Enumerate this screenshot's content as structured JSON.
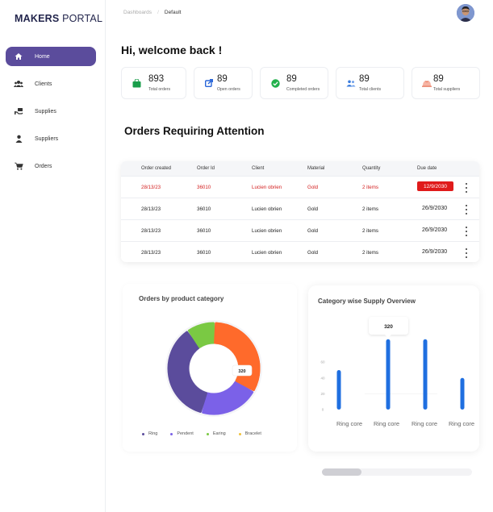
{
  "brand": {
    "bold": "MAKERS",
    "light": "PORTAL"
  },
  "nav": [
    {
      "label": "Home",
      "icon": "home-icon",
      "active": true
    },
    {
      "label": "Clients",
      "icon": "users-icon"
    },
    {
      "label": "Supplies",
      "icon": "supplies-icon"
    },
    {
      "label": "Suppliers",
      "icon": "person-icon"
    },
    {
      "label": "Orders",
      "icon": "cart-icon"
    }
  ],
  "breadcrumb": {
    "parent": "Dashboards",
    "separator": "/",
    "current": "Default"
  },
  "welcome": "Hi, welcome back !",
  "stats": [
    {
      "value": "893",
      "label": "Total orders",
      "icon": "bag-icon",
      "color": "#1a9e4b"
    },
    {
      "value": "89",
      "label": "Open orders",
      "icon": "open-box-icon",
      "color": "#2a66d8"
    },
    {
      "value": "89",
      "label": "Completed orders",
      "icon": "check-circle-icon",
      "color": "#22b14c"
    },
    {
      "value": "89",
      "label": "Total clients",
      "icon": "clients-icon",
      "color": "#3b7ddd"
    },
    {
      "value": "89",
      "label": "Total suppliers",
      "icon": "suppliers-icon",
      "color": "#e8785e"
    }
  ],
  "orders_title": "Orders Requiring  Attention",
  "table": {
    "columns": [
      "Order created",
      "Order Id",
      "Client",
      "Material",
      "Quantity",
      "Due date"
    ],
    "rows": [
      {
        "created": "28/13/23",
        "id": "36010",
        "client": "Lucien obrien",
        "material": "Gold",
        "quantity": "2 items",
        "due": "12/9/2030",
        "alert": true
      },
      {
        "created": "28/13/23",
        "id": "36010",
        "client": "Lucien obrien",
        "material": "Gold",
        "quantity": "2 items",
        "due": "26/9/2030",
        "alert": false
      },
      {
        "created": "28/13/23",
        "id": "36010",
        "client": "Lucien obrien",
        "material": "Gold",
        "quantity": "2 items",
        "due": "26/9/2030",
        "alert": false
      },
      {
        "created": "28/13/23",
        "id": "36010",
        "client": "Lucien obrien",
        "material": "Gold",
        "quantity": "2 items",
        "due": "26/9/2030",
        "alert": false
      }
    ]
  },
  "donut": {
    "title": "Orders by product category",
    "tooltip": "320",
    "legend": [
      {
        "label": "Ring",
        "color": "#5b4c9c"
      },
      {
        "label": "Pendent",
        "color": "#7b61e8"
      },
      {
        "label": "Earing",
        "color": "#7ac943"
      },
      {
        "label": "Bracelet",
        "color": "#f0c23b"
      }
    ]
  },
  "bar": {
    "title": "Category wise Supply Overview",
    "tooltip": "320"
  },
  "colors": {
    "accent": "#5b4c9c",
    "alert": "#e01b1b",
    "bar": "#1f6fe0"
  },
  "chart_data": [
    {
      "type": "pie",
      "title": "Orders by product category",
      "labels": [
        "Ring",
        "Pendent",
        "Earing",
        "Bracelet"
      ],
      "values": [
        36,
        21,
        10,
        33
      ],
      "colors": [
        "#5b4c9c",
        "#7b61e8",
        "#7ac943",
        "#ff6a2b"
      ],
      "annotation": "320"
    },
    {
      "type": "bar",
      "title": "Category wise Supply Overview",
      "categories": [
        "Ring core",
        "Ring core",
        "Ring core",
        "Ring core",
        "Ring core"
      ],
      "values": [
        50,
        89,
        89,
        40,
        null
      ],
      "ytick_labels": [
        "0",
        "20",
        "40",
        "60"
      ],
      "annotation": "320"
    }
  ]
}
